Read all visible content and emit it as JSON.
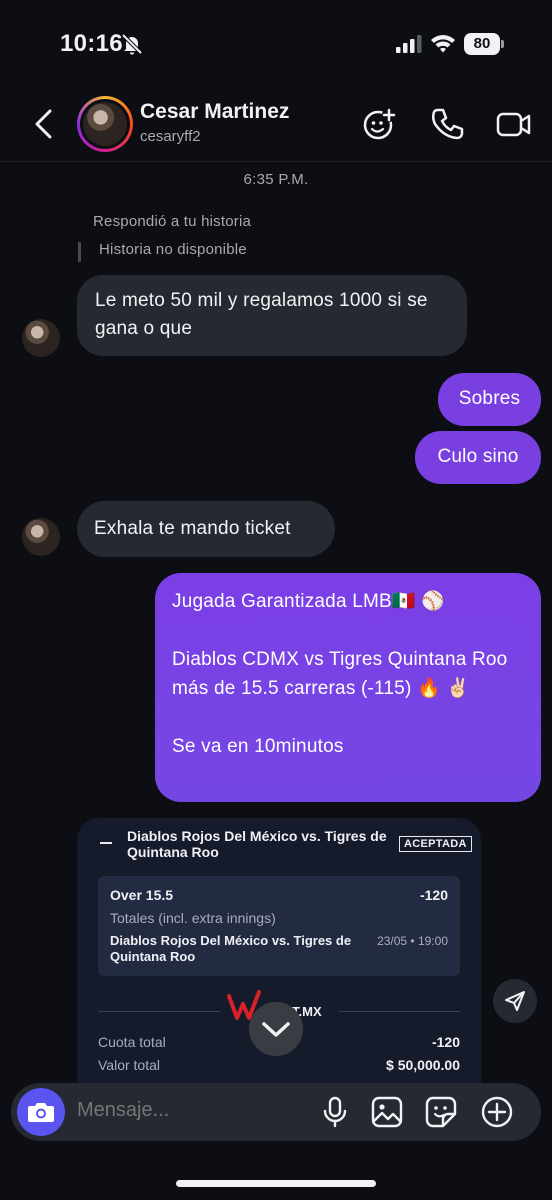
{
  "status": {
    "time": "10:16",
    "battery": "80"
  },
  "header": {
    "name": "Cesar Martinez",
    "username": "cesaryff2"
  },
  "thread": {
    "timestamp": "6:35 P.M.",
    "replied_label": "Respondió a tu historia",
    "story_unavailable": "Historia no disponible",
    "messages": [
      {
        "from": "them",
        "text": "Le meto 50 mil y regalamos 1000 si se gana o que"
      },
      {
        "from": "me",
        "text": "Sobres"
      },
      {
        "from": "me",
        "text": "Culo sino"
      },
      {
        "from": "them",
        "text": "Exhala te mando ticket"
      },
      {
        "from": "me",
        "lines": [
          "Jugada Garantizada LMB🇲🇽 ⚾",
          "Diablos CDMX vs Tigres Quintana Roo más de 15.5 carreras (-115) 🔥 ✌🏻",
          "Se va en 10minutos"
        ]
      }
    ]
  },
  "ticket": {
    "title": "Diablos Rojos Del México vs. Tigres de Quintana Roo",
    "status": "ACEPTADA",
    "selection": "Over 15.5",
    "odds": "-120",
    "market": "Totales (incl. extra innings)",
    "event": "Diablos Rojos Del México vs. Tigres de Quintana Roo",
    "date": "23/05 • 19:00",
    "brand_suffix": "T.MX",
    "total_odds_label": "Cuota total",
    "total_odds": "-120",
    "total_value_label": "Valor total",
    "total_value": "$ 50,000.00"
  },
  "composer": {
    "placeholder": "Mensaje..."
  }
}
